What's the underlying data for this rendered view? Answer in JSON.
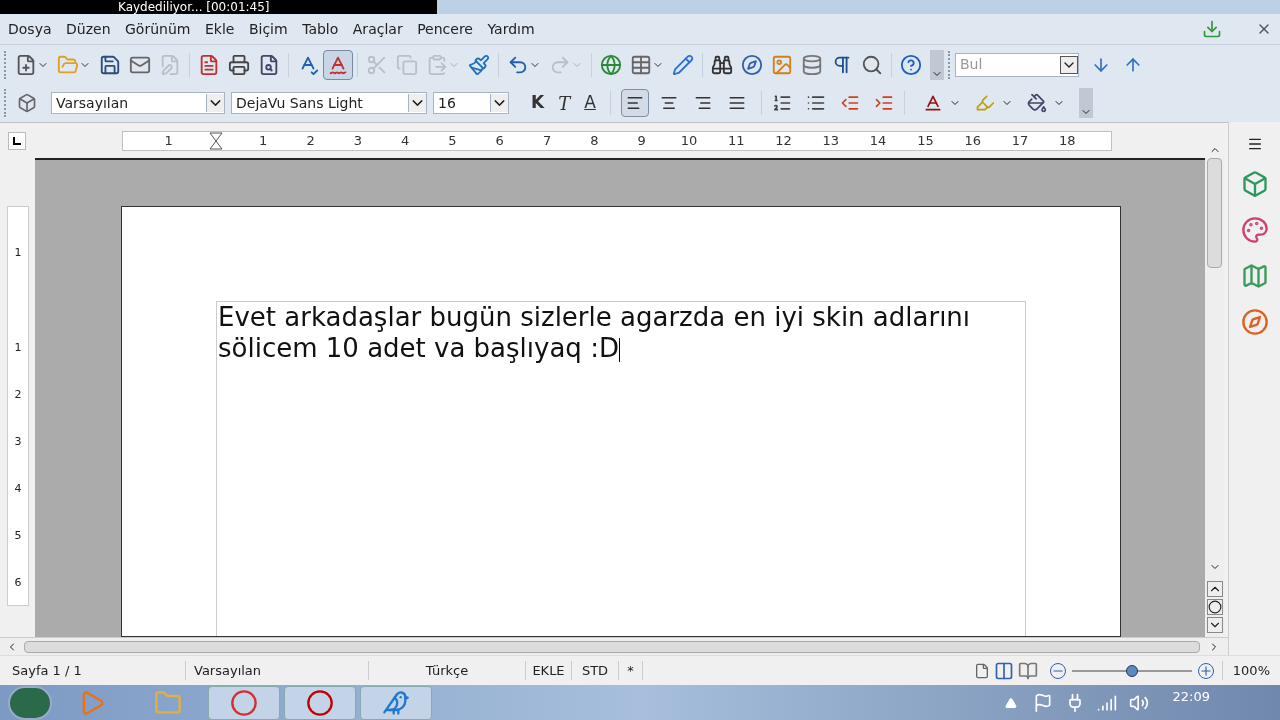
{
  "recorder_bar": {
    "status": "Kaydediliyor... [00:01:45]"
  },
  "menu": [
    {
      "label": "Dosya"
    },
    {
      "label": "Düzen"
    },
    {
      "label": "Görünüm"
    },
    {
      "label": "Ekle"
    },
    {
      "label": "Biçim"
    },
    {
      "label": "Tablo"
    },
    {
      "label": "Araçlar"
    },
    {
      "label": "Pencere"
    },
    {
      "label": "Yardım"
    }
  ],
  "standard_toolbar": {
    "buttons": [
      {
        "disabled": false,
        "selected": false
      },
      {
        "disabled": false,
        "selected": false
      },
      {
        "disabled": false,
        "selected": false
      },
      {
        "disabled": false,
        "selected": false
      },
      {
        "disabled": true,
        "selected": false
      },
      {
        "disabled": false,
        "selected": false
      },
      {
        "disabled": false,
        "selected": false
      },
      {
        "disabled": false,
        "selected": false
      },
      {
        "disabled": false,
        "selected": false
      },
      {
        "disabled": false,
        "selected": true
      },
      {
        "disabled": true,
        "selected": false
      },
      {
        "disabled": true,
        "selected": false
      },
      {
        "disabled": true,
        "selected": false
      },
      {
        "disabled": false,
        "selected": false
      },
      {
        "disabled": false,
        "selected": false
      },
      {
        "disabled": true,
        "selected": false
      },
      {
        "disabled": false,
        "selected": false
      },
      {
        "disabled": false,
        "selected": false
      },
      {
        "disabled": false,
        "selected": false
      },
      {
        "disabled": false,
        "selected": false
      },
      {
        "disabled": false,
        "selected": false
      },
      {
        "disabled": false,
        "selected": false
      },
      {
        "disabled": false,
        "selected": false
      },
      {
        "disabled": false,
        "selected": false
      },
      {
        "disabled": false,
        "selected": false
      },
      {
        "disabled": false,
        "selected": false
      }
    ]
  },
  "find_bar": {
    "placeholder": "Bul"
  },
  "formatting_toolbar": {
    "paragraph_style": "Varsayılan",
    "font_name": "DejaVu Sans Light",
    "font_size": "16",
    "bold": "K",
    "italic": "T",
    "underline": "A",
    "align": [
      {
        "selected": true
      },
      {
        "selected": false
      },
      {
        "selected": false
      },
      {
        "selected": false
      }
    ]
  },
  "ruler": [
    "1",
    "1",
    "2",
    "3",
    "4",
    "5",
    "6",
    "7",
    "8",
    "9",
    "10",
    "11",
    "12",
    "13",
    "14",
    "15",
    "16",
    "17",
    "18"
  ],
  "vertical_ruler": [
    "1",
    "1",
    "2",
    "3",
    "4",
    "5",
    "6"
  ],
  "document": {
    "text": "Evet arkadaşlar bugün sizlerle agarzda en iyi skin adlarını sölicem 10 adet va başlıyaq :D"
  },
  "status_bar": {
    "page": "Sayfa 1 / 1",
    "style": "Varsayılan",
    "language": "Türkçe",
    "insert_mode": "EKLE",
    "selection_mode": "STD",
    "modified": "*",
    "zoom": {
      "level": 0.5
    },
    "zoom_text": "100%"
  },
  "taskbar": {
    "apps": [
      {
        "selected": false
      },
      {
        "selected": false
      },
      {
        "selected": true
      },
      {
        "selected": true
      },
      {
        "selected": true
      }
    ],
    "clock": "22:09"
  }
}
